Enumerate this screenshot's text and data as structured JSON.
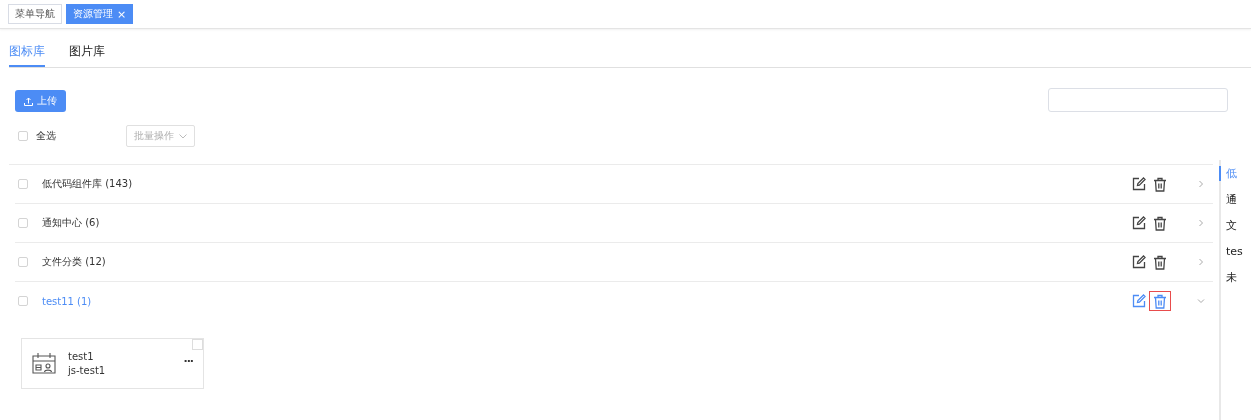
{
  "top_tabs": [
    {
      "label": "菜单导航",
      "selected": false
    },
    {
      "label": "资源管理",
      "selected": true,
      "close": "×"
    }
  ],
  "sub_tabs": [
    {
      "label": "图标库",
      "selected": true
    },
    {
      "label": "图片库",
      "selected": false
    }
  ],
  "upload_button": "上传",
  "select_all": {
    "label": "全选",
    "checked": false
  },
  "batch_dropdown": {
    "label": "批量操作",
    "disabled": true
  },
  "groups": [
    {
      "name": "低代码组件库 (143)",
      "checked": false,
      "expanded": false,
      "delete_focused": false
    },
    {
      "name": "通知中心 (6)",
      "checked": false,
      "expanded": false,
      "delete_focused": false
    },
    {
      "name": "文件分类 (12)",
      "checked": false,
      "expanded": false,
      "delete_focused": false
    },
    {
      "name": "test11 (1)",
      "checked": false,
      "expanded": true,
      "delete_focused": true,
      "icons": [
        {
          "name": "test1",
          "code": "js-test1",
          "more": "···",
          "checked": false
        }
      ]
    }
  ],
  "anchors": [
    {
      "label": "低",
      "selected": true
    },
    {
      "label": "通",
      "selected": false
    },
    {
      "label": "文",
      "selected": false
    },
    {
      "label": "tes",
      "selected": false
    },
    {
      "label": "未",
      "selected": false
    }
  ]
}
